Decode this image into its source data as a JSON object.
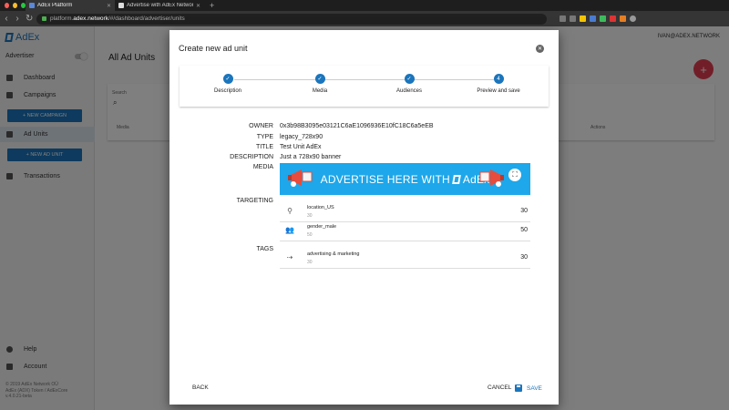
{
  "browser": {
    "tabs": [
      {
        "label": "AdEx Platform",
        "active": true
      },
      {
        "label": "Advertise with AdEx Network",
        "active": false
      }
    ],
    "url_prefix": "platform.",
    "url_host": "adex.network",
    "url_path": "/#/dashboard/advertiser/units"
  },
  "sidebar": {
    "logo": "AdEx",
    "role": "Advertiser",
    "items": [
      {
        "label": "Dashboard",
        "icon": "dashboard-icon"
      },
      {
        "label": "Campaigns",
        "icon": "campaigns-icon"
      },
      {
        "label": "Ad Units",
        "icon": "list-icon"
      },
      {
        "label": "Transactions",
        "icon": "swap-icon"
      }
    ],
    "new_campaign": "+ NEW CAMPAIGN",
    "new_ad_unit": "+ NEW AD UNIT",
    "help": "Help",
    "account": "Account",
    "footer": [
      "© 2019 AdEx Network OÜ",
      "AdEx (ADX) Token / AdExCore",
      "v.4.0.21-beta"
    ]
  },
  "main": {
    "title": "All Ad Units",
    "user": "IVAN@ADEX.NETWORK",
    "search_label": "Search",
    "col_media": "Media",
    "col_actions": "Actions"
  },
  "modal": {
    "title": "Create new ad unit",
    "steps": [
      {
        "label": "Description",
        "mark": "✓"
      },
      {
        "label": "Media",
        "mark": "✓"
      },
      {
        "label": "Audiences",
        "mark": "✓"
      },
      {
        "label": "Preview and save",
        "mark": "4"
      }
    ],
    "details": {
      "owner_label": "OWNER",
      "owner": "0x3b98B3095e03121C6aE1096936E10fC18C6a5eEB",
      "type_label": "TYPE",
      "type": "legacy_728x90",
      "title_label": "TITLE",
      "title": "Test Unit AdEx",
      "description_label": "DESCRIPTION",
      "description": "Just a 728x90 banner",
      "media_label": "MEDIA",
      "targeting_label": "TARGETING",
      "tags_label": "TAGS"
    },
    "banner_text": "ADVERTISE HERE WITH",
    "banner_brand": "AdEx",
    "targeting": [
      {
        "name": "location_US",
        "sub": "30",
        "value": "30",
        "icon": "location-pin-icon"
      },
      {
        "name": "gender_male",
        "sub": "50",
        "value": "50",
        "icon": "people-icon"
      }
    ],
    "tags": [
      {
        "name": "advertising & marketing",
        "sub": "30",
        "value": "30",
        "icon": "tag-icon"
      }
    ],
    "back": "BACK",
    "cancel": "CANCEL",
    "save": "SAVE"
  }
}
